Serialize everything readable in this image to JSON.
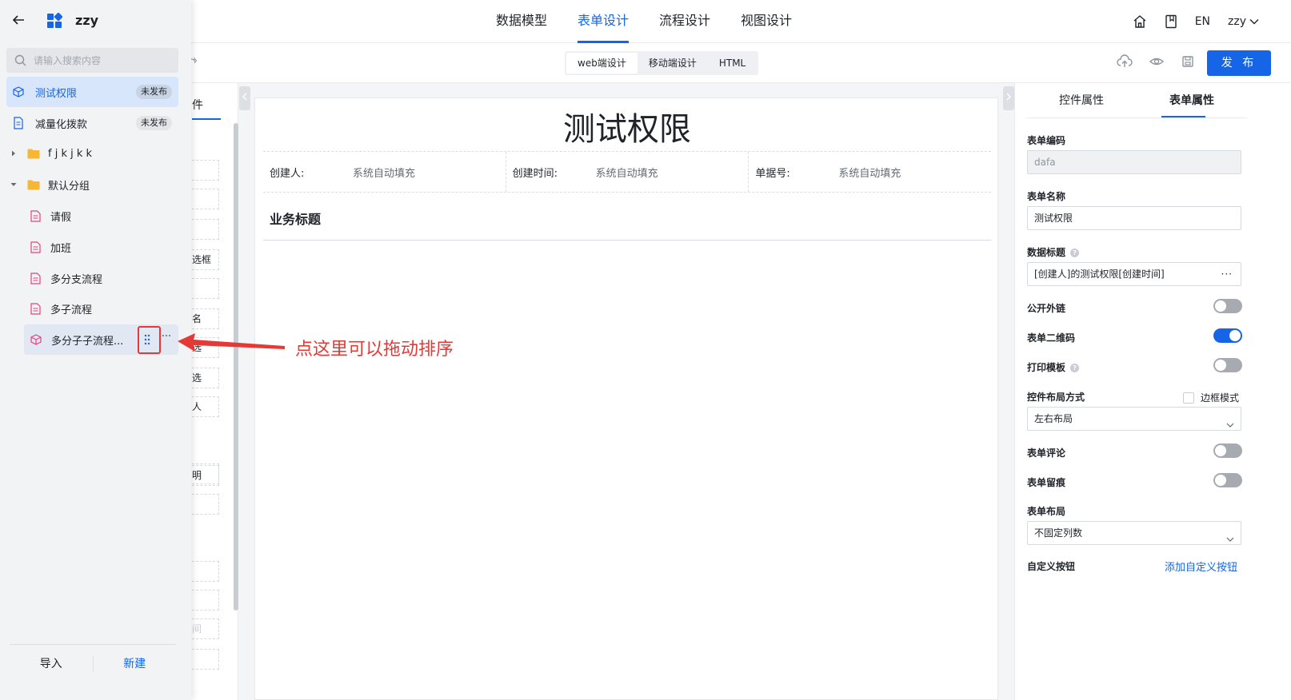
{
  "app": {
    "name": "zzy"
  },
  "top_nav": {
    "tabs": [
      {
        "label": "数据模型"
      },
      {
        "label": "表单设计"
      },
      {
        "label": "流程设计"
      },
      {
        "label": "视图设计"
      }
    ],
    "active_tab": "表单设计",
    "lang": "EN",
    "user": "zzy"
  },
  "toolbar": {
    "modes": [
      {
        "label": "web端设计"
      },
      {
        "label": "移动端设计"
      },
      {
        "label": "HTML"
      }
    ],
    "active_mode": "web端设计",
    "publish_label": "发 布"
  },
  "sidebar": {
    "search_placeholder": "请输入搜索内容",
    "items": [
      {
        "label": "测试权限",
        "badge": "未发布",
        "icon": "cube-icon"
      },
      {
        "label": "减量化拨款",
        "badge": "未发布",
        "icon": "document-icon"
      },
      {
        "label": "f j k j k k",
        "icon": "folder-icon"
      },
      {
        "label": "默认分组",
        "icon": "folder-icon"
      },
      {
        "label": "请假",
        "icon": "form-icon"
      },
      {
        "label": "加班",
        "icon": "form-icon"
      },
      {
        "label": "多分支流程",
        "icon": "form-icon"
      },
      {
        "label": "多子流程",
        "icon": "form-icon"
      },
      {
        "label": "多分子子流程...",
        "icon": "cube-icon"
      }
    ],
    "footer": {
      "import_label": "导入",
      "new_label": "新建"
    }
  },
  "components_panel": {
    "tab_fragment": "件",
    "items": [
      "",
      "",
      "",
      "选框",
      "",
      "名",
      "选",
      "选",
      "人",
      "",
      "明",
      "",
      "",
      "",
      "间",
      ""
    ]
  },
  "form": {
    "title": "测试权限",
    "meta": [
      {
        "label": "创建人:",
        "value": "系统自动填充"
      },
      {
        "label": "创建时间:",
        "value": "系统自动填充"
      },
      {
        "label": "单据号:",
        "value": "系统自动填充"
      }
    ],
    "section_title": "业务标题"
  },
  "properties": {
    "tabs": [
      {
        "label": "控件属性"
      },
      {
        "label": "表单属性"
      }
    ],
    "active_tab": "表单属性",
    "form_code": {
      "label": "表单编码",
      "value": "dafa"
    },
    "form_name": {
      "label": "表单名称",
      "value": "测试权限"
    },
    "data_title": {
      "label": "数据标题",
      "value": "[创建人]的测试权限[创建时间]"
    },
    "public_link": {
      "label": "公开外链",
      "on": false
    },
    "qr_code": {
      "label": "表单二维码",
      "on": true
    },
    "print_template": {
      "label": "打印模板",
      "on": false
    },
    "control_layout": {
      "label": "控件布局方式",
      "checkbox_label": "边框模式",
      "checked": false,
      "value": "左右布局"
    },
    "comment": {
      "label": "表单评论",
      "on": false
    },
    "trace": {
      "label": "表单留痕",
      "on": false
    },
    "form_layout": {
      "label": "表单布局",
      "value": "不固定列数"
    },
    "custom_button": {
      "label": "自定义按钮",
      "link": "添加自定义按钮"
    }
  },
  "annotation": {
    "text": "点这里可以拖动排序"
  },
  "colors": {
    "accent": "#1665e6",
    "annotation": "#e53935"
  }
}
